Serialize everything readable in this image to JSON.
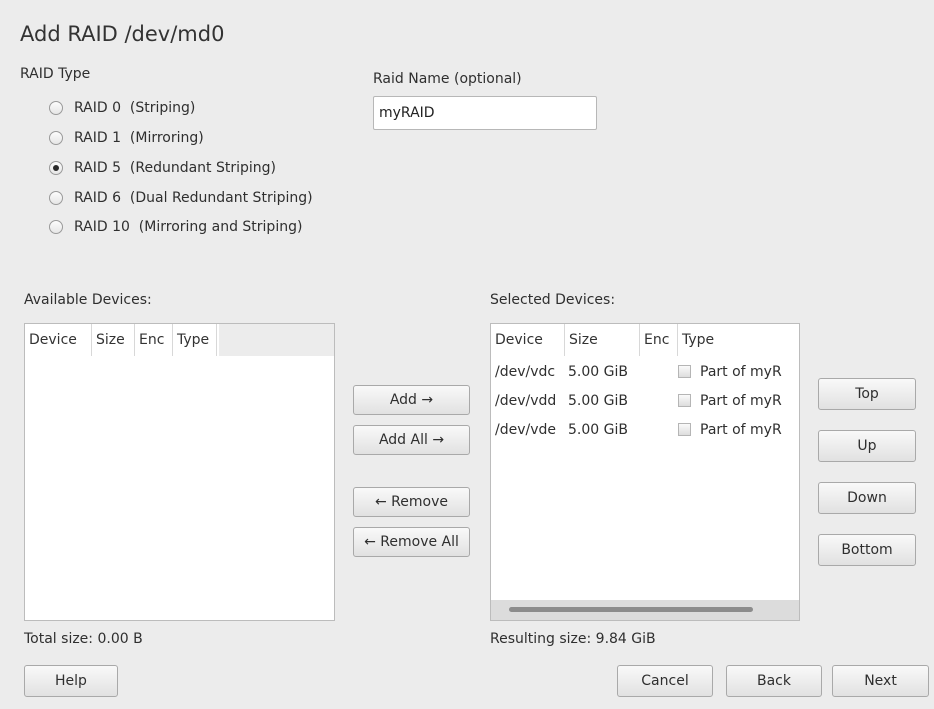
{
  "dialog": {
    "title": "Add RAID /dev/md0"
  },
  "raid_type": {
    "label": "RAID Type",
    "options": [
      {
        "label": "RAID 0  (Striping)",
        "checked": false
      },
      {
        "label": "RAID 1  (Mirroring)",
        "checked": false
      },
      {
        "label": "RAID 5  (Redundant Striping)",
        "checked": true
      },
      {
        "label": "RAID 6  (Dual Redundant Striping)",
        "checked": false
      },
      {
        "label": "RAID 10  (Mirroring and Striping)",
        "checked": false
      }
    ]
  },
  "raid_name": {
    "label": "Raid Name (optional)",
    "value": "myRAID"
  },
  "available": {
    "label": "Available Devices:",
    "columns": [
      "Device",
      "Size",
      "Enc",
      "Type"
    ],
    "rows": [],
    "total": "Total size: 0.00 B"
  },
  "transfer": {
    "add": "Add →",
    "add_all": "Add All →",
    "remove": "← Remove",
    "remove_all": "← Remove All"
  },
  "selected": {
    "label": "Selected Devices:",
    "columns": [
      "Device",
      "Size",
      "Enc",
      "Type"
    ],
    "rows": [
      {
        "device": "/dev/vdc",
        "size": "5.00 GiB",
        "enc": "",
        "type": "Part of myR"
      },
      {
        "device": "/dev/vdd",
        "size": "5.00 GiB",
        "enc": "",
        "type": "Part of myR"
      },
      {
        "device": "/dev/vde",
        "size": "5.00 GiB",
        "enc": "",
        "type": "Part of myR"
      }
    ],
    "resulting": "Resulting size: 9.84 GiB"
  },
  "order": {
    "top": "Top",
    "up": "Up",
    "down": "Down",
    "bottom": "Bottom"
  },
  "footer": {
    "help": "Help",
    "cancel": "Cancel",
    "back": "Back",
    "next": "Next"
  }
}
